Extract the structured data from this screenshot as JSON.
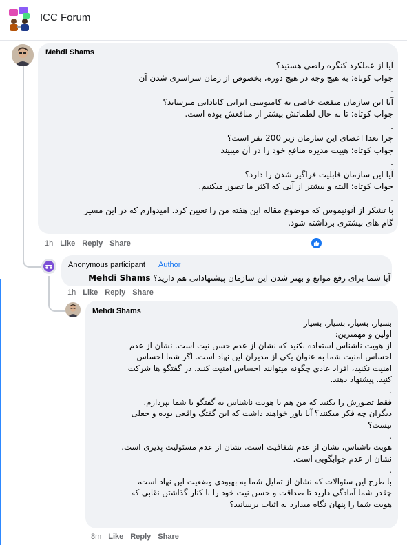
{
  "group": {
    "title": "ICC Forum"
  },
  "comments": [
    {
      "author": "Mehdi Shams",
      "text": "آیا از عملکرد کنگره راضی هستید؟\nجواب کوتاه: به هیچ وجه در هیچ دوره، بخصوص از زمان سراسری شدن آن\n.\nآیا این سازمان منفعت خاصی به کامیونیتی ایرانی کانادایی میرساند؟\nجواب کوتاه: تا به حال لطماتش بیشتر از منافعش بوده است.\n.\nچرا تعدا اعضای این سازمان زیر 200 نفر است؟\nجواب کوتاه: هییت مدیره منافع خود را در آن میبیند\n.\nآیا این سازمان قابلیت فراگیر شدن را دارد؟\nجواب کوتاه: البته و بیشتر از آنی که اکثر ما تصور میکنیم.\n.\nبا تشکر از آنونیموس که موضوع مقاله این هفته من را تعیین کرد. امیدوارم که در این مسیر\nگام های بیشتری برداشته شود.",
      "time": "1h",
      "like_label": "Like",
      "reply_label": "Reply",
      "share_label": "Share",
      "reaction_icon": "thumbs-up-icon"
    },
    {
      "author": "Anonymous participant",
      "badge": "Author",
      "mention": "Mehdi Shams",
      "text": "آیا شما برای رفع موانع و بهتر شدن این سازمان پیشنهاداتی هم دارید؟",
      "time": "1h",
      "like_label": "Like",
      "reply_label": "Reply",
      "share_label": "Share"
    },
    {
      "author": "Mehdi Shams",
      "text": "بسیار، بسیار، بسیار، بسیار\nاولین و مهمترین:\nاز هویت ناشناس استفاده نکنید که نشان از عدم حسن نیت است. نشان از عدم\nاحساس امنیت شما به عنوان یکی از مدیران این نهاد است. اگر شما احساس\nامنیت نکنید، افراد عادی چگونه میتوانند احساس امنیت کنند. در گفتگو ها شرکت\nکنید. پیشنهاد دهند.\n.\nفقط تصورش را بکنید که من هم با هویت ناشناس به گفتگو با شما بپردازم.\nدیگران چه فکر میکنند؟ آیا باور خواهند داشت که این گفتگ واقعی بوده و جعلی\nنیست؟\n.\nهویت ناشناس، نشان از عدم شفافیت است. نشان از عدم مسئولیت پذیری است.\nنشان از عدم جوابگویی است.\n.\nبا طرح این سئوالات که نشان از تمایل شما به بهبودی وضعیت این نهاد است،\nچقدر شما آمادگی دارید تا صداقت و حسن نیت خود را با کنار گذاشتن نقابی که\nهویت شما را پنهان نگاه میدارد به اثبات برسانید؟",
      "time": "8m",
      "like_label": "Like",
      "reply_label": "Reply",
      "share_label": "Share"
    }
  ]
}
